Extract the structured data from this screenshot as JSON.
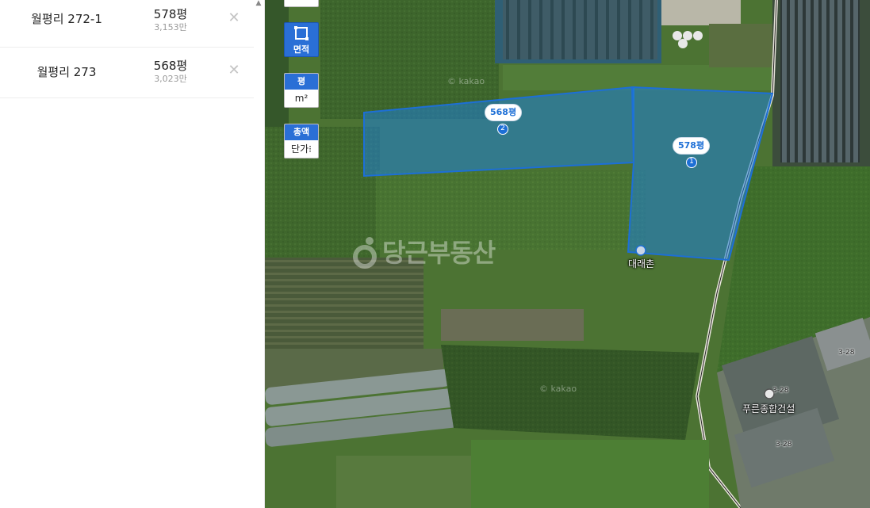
{
  "list": [
    {
      "address": "월평리 272-1",
      "area": "578평",
      "price": "3,153만"
    },
    {
      "address": "월평리 273",
      "area": "568평",
      "price": "3,023만"
    }
  ],
  "controls": {
    "area_button": "면적",
    "unit_toggle": {
      "selected": "평",
      "other": "m²"
    },
    "price_toggle": {
      "selected": "총액",
      "other": "단가"
    }
  },
  "map": {
    "parcels": [
      {
        "area_label": "578평",
        "number": "1"
      },
      {
        "area_label": "568평",
        "number": "2"
      }
    ],
    "pois": [
      "대래촌",
      "푸른종합건설"
    ],
    "road_numbers": [
      "3-28",
      "3-28",
      "3-28"
    ],
    "watermark": "당근부동산",
    "provider_marks": [
      "© kakao",
      "© kakao"
    ],
    "colors": {
      "parcel_fill": "#1f7fd6",
      "parcel_stroke": "#1d6fd6",
      "accent": "#2a6fd6"
    }
  }
}
